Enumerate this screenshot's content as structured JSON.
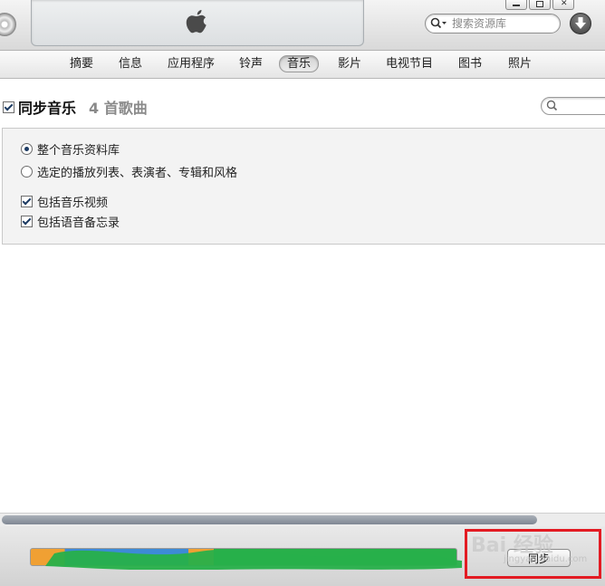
{
  "search": {
    "placeholder": "搜索资源库"
  },
  "tabs": [
    {
      "label": "摘要",
      "active": false
    },
    {
      "label": "信息",
      "active": false
    },
    {
      "label": "应用程序",
      "active": false
    },
    {
      "label": "铃声",
      "active": false
    },
    {
      "label": "音乐",
      "active": true
    },
    {
      "label": "影片",
      "active": false
    },
    {
      "label": "电视节目",
      "active": false
    },
    {
      "label": "图书",
      "active": false
    },
    {
      "label": "照片",
      "active": false
    }
  ],
  "sync": {
    "title": "同步音乐",
    "checked": true,
    "count": "4 首歌曲"
  },
  "options": {
    "entire_library": {
      "label": "整个音乐资料库",
      "selected": true
    },
    "selected_items": {
      "label": "选定的播放列表、表演者、专辑和风格",
      "selected": false
    },
    "include_videos": {
      "label": "包括音乐视频",
      "checked": true
    },
    "include_voice_memos": {
      "label": "包括语音备忘录",
      "checked": true
    }
  },
  "bottom": {
    "sync_button": "同步",
    "scrollbar_fraction": 0.89
  },
  "colors": {
    "highlight": "#e31b23",
    "capacity_green": "#28b04a",
    "capacity_blue": "#3d8bd6",
    "capacity_orange": "#f0a033"
  },
  "watermark": {
    "text": "Bai 经验",
    "sub": "jingyan.baidu.com"
  },
  "icons": [
    "disc-icon",
    "apple-logo-icon",
    "search-icon",
    "download-icon",
    "filter-search-icon"
  ]
}
